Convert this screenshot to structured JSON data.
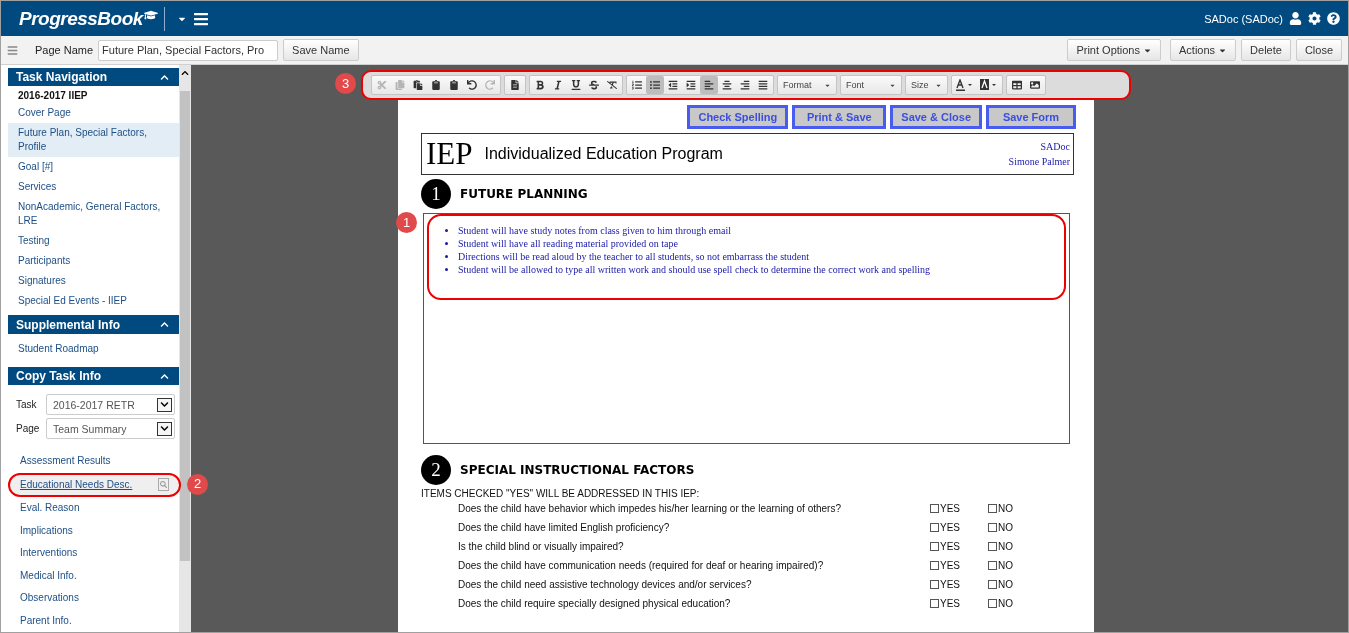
{
  "header": {
    "logo": "ProgressBook",
    "user": "SADoc (SADoc)"
  },
  "page_bar": {
    "label": "Page Name",
    "value": "Future Plan, Special Factors, Pro",
    "save": "Save Name",
    "buttons": [
      {
        "label": "Print Options",
        "dropdown": true
      },
      {
        "label": "Actions",
        "dropdown": true
      },
      {
        "label": "Delete",
        "dropdown": false
      },
      {
        "label": "Close",
        "dropdown": false
      }
    ]
  },
  "sidebar": {
    "sections": [
      {
        "title": "Task Navigation",
        "subtitle": "2016-2017 IIEP",
        "items": [
          {
            "label": "Cover Page",
            "selected": false
          },
          {
            "label": "Future Plan, Special Factors, Profile",
            "selected": true
          },
          {
            "label": "Goal [#]",
            "selected": false
          },
          {
            "label": "Services",
            "selected": false
          },
          {
            "label": "NonAcademic, General Factors, LRE",
            "selected": false
          },
          {
            "label": "Testing",
            "selected": false
          },
          {
            "label": "Participants",
            "selected": false
          },
          {
            "label": "Signatures",
            "selected": false
          },
          {
            "label": "Special Ed Events - IIEP",
            "selected": false
          }
        ]
      },
      {
        "title": "Supplemental Info",
        "items": [
          {
            "label": "Student Roadmap",
            "selected": false
          }
        ]
      },
      {
        "title": "Copy Task Info",
        "selects": [
          {
            "label": "Task",
            "value": "2016-2017 RETR"
          },
          {
            "label": "Page",
            "value": "Team Summary"
          }
        ],
        "items": [
          {
            "label": "Assessment Results",
            "selected": false
          },
          {
            "label": "Educational Needs Desc.",
            "selected": true,
            "callout": "2"
          },
          {
            "label": "Eval. Reason",
            "selected": false
          },
          {
            "label": "Implications",
            "selected": false
          },
          {
            "label": "Interventions",
            "selected": false
          },
          {
            "label": "Medical Info.",
            "selected": false
          },
          {
            "label": "Observations",
            "selected": false
          },
          {
            "label": "Parent Info.",
            "selected": false
          }
        ]
      }
    ]
  },
  "editor_toolbar": {
    "callout": "3",
    "groups": [
      [
        {
          "kind": "button",
          "disabled": true,
          "selected": false
        },
        {
          "kind": "button",
          "disabled": true,
          "selected": false
        },
        {
          "kind": "button",
          "disabled": false,
          "selected": false
        },
        {
          "kind": "button",
          "disabled": false,
          "selected": false
        },
        {
          "kind": "button",
          "disabled": false,
          "selected": false
        },
        {
          "kind": "button",
          "disabled": false,
          "selected": false
        },
        {
          "kind": "button",
          "disabled": true,
          "selected": false
        }
      ],
      [
        {
          "kind": "button",
          "disabled": false,
          "selected": false
        }
      ],
      [
        {
          "kind": "button",
          "disabled": false,
          "selected": false
        },
        {
          "kind": "button",
          "disabled": false,
          "selected": false
        },
        {
          "kind": "button",
          "disabled": false,
          "selected": false
        },
        {
          "kind": "button",
          "disabled": false,
          "selected": false
        },
        {
          "kind": "button",
          "disabled": false,
          "selected": false
        }
      ],
      [
        {
          "kind": "button",
          "disabled": false,
          "selected": false
        },
        {
          "kind": "button",
          "disabled": false,
          "selected": true
        },
        {
          "kind": "button",
          "disabled": false,
          "selected": false
        },
        {
          "kind": "button",
          "disabled": false,
          "selected": false
        },
        {
          "kind": "button",
          "disabled": false,
          "selected": true
        },
        {
          "kind": "button",
          "disabled": false,
          "selected": false
        },
        {
          "kind": "button",
          "disabled": false,
          "selected": false
        },
        {
          "kind": "button",
          "disabled": false,
          "selected": false
        }
      ],
      [
        {
          "kind": "dropdown",
          "label": "Format"
        },
        {
          "kind": "dropdown",
          "label": "Font"
        },
        {
          "kind": "dropdown",
          "label": "Size"
        }
      ],
      [
        {
          "kind": "button",
          "disabled": false,
          "selected": false
        },
        {
          "kind": "button",
          "disabled": false,
          "selected": false
        }
      ],
      [
        {
          "kind": "button",
          "disabled": false,
          "selected": false
        },
        {
          "kind": "button",
          "disabled": false,
          "selected": false
        }
      ]
    ]
  },
  "form_actions": [
    "Check Spelling",
    "Print & Save",
    "Save & Close",
    "Save Form"
  ],
  "document": {
    "logo": "IEP",
    "title": "Individualized Education Program",
    "author_lines": [
      "SADoc",
      "Simone Palmer"
    ],
    "future_planning": {
      "number": "1",
      "heading": "FUTURE PLANNING",
      "callout": "1",
      "bullets": [
        "Student will have study notes from class given to him through email",
        "Student will have all reading material provided on tape",
        "Directions will be read aloud by the teacher to all students, so not embarrass the student",
        "Student will be allowed to type all written work and should use spell check to determine the correct work and spelling"
      ]
    },
    "special_factors": {
      "number": "2",
      "heading": "SPECIAL INSTRUCTIONAL FACTORS",
      "intro": "ITEMS CHECKED \"YES\" WILL BE ADDRESSED IN THIS IEP:",
      "questions": [
        {
          "text": "Does the child have behavior which impedes his/her learning or the learning of others?",
          "yes_label": "YES",
          "yes": false,
          "no_label": "NO",
          "no": false
        },
        {
          "text": "Does the child have limited English proficiency?",
          "yes_label": "YES",
          "yes": false,
          "no_label": "NO",
          "no": false
        },
        {
          "text": "Is the child blind or visually impaired?",
          "yes_label": "YES",
          "yes": false,
          "no_label": "NO",
          "no": false
        },
        {
          "text": "Does the child have communication needs (required for deaf or hearing impaired)?",
          "yes_label": "YES",
          "yes": false,
          "no_label": "NO",
          "no": false
        },
        {
          "text": "Does the child need assistive technology devices and/or services?",
          "yes_label": "YES",
          "yes": false,
          "no_label": "NO",
          "no": false
        },
        {
          "text": "Does the child require specially designed physical education?",
          "yes_label": "YES",
          "yes": false,
          "no_label": "NO",
          "no": false
        }
      ]
    }
  }
}
